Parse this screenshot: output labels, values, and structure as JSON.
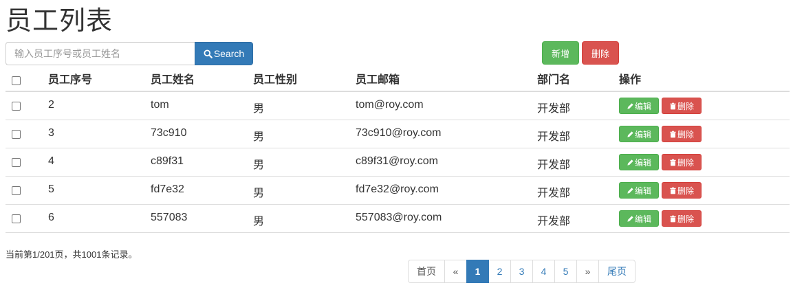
{
  "page": {
    "title": "员工列表"
  },
  "search": {
    "placeholder": "输入员工序号或员工姓名",
    "button_label": "Search"
  },
  "toolbar": {
    "add_label": "新增",
    "delete_label": "删除"
  },
  "table": {
    "headers": [
      "员工序号",
      "员工姓名",
      "员工性别",
      "员工邮箱",
      "部门名",
      "操作"
    ],
    "rows": [
      {
        "id": "2",
        "name": "tom",
        "gender": "男",
        "email": "tom@roy.com",
        "dept": "开发部"
      },
      {
        "id": "3",
        "name": "73c910",
        "gender": "男",
        "email": "73c910@roy.com",
        "dept": "开发部"
      },
      {
        "id": "4",
        "name": "c89f31",
        "gender": "男",
        "email": "c89f31@roy.com",
        "dept": "开发部"
      },
      {
        "id": "5",
        "name": "fd7e32",
        "gender": "男",
        "email": "fd7e32@roy.com",
        "dept": "开发部"
      },
      {
        "id": "6",
        "name": "557083",
        "gender": "男",
        "email": "557083@roy.com",
        "dept": "开发部"
      }
    ],
    "row_actions": {
      "edit_label": "编辑",
      "delete_label": "删除"
    }
  },
  "footer": {
    "page_info": "当前第1/201页，共1001条记录。"
  },
  "pagination": {
    "first_label": "首页",
    "prev_label": "«",
    "pages": [
      "1",
      "2",
      "3",
      "4",
      "5"
    ],
    "active_page": "1",
    "next_label": "»",
    "last_label": "尾页"
  },
  "colors": {
    "primary": "#337ab7",
    "success": "#5cb85c",
    "danger": "#d9534f"
  },
  "icons": {
    "search": "search-icon",
    "edit": "pencil-icon",
    "delete": "trash-icon"
  }
}
